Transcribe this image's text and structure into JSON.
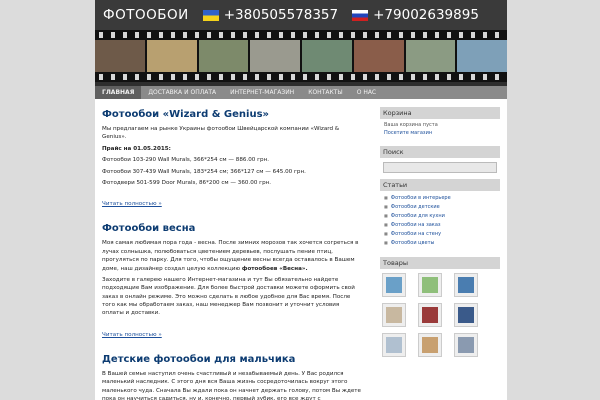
{
  "header": {
    "site_title": "ФОТООБОИ",
    "phone_ua": "+380505578357",
    "phone_ru": "+79002639895",
    "frame_colors": [
      "#6e5a49",
      "#b8a070",
      "#7d8a6a",
      "#9a9a8f",
      "#6f8a73",
      "#8a5d4a",
      "#8b9b83",
      "#7ea0b8"
    ]
  },
  "nav": {
    "items": [
      "Главная",
      "ДОСТАВКА И ОПЛАТА",
      "ИНТЕРНЕТ-МАГАЗИН",
      "КОНТАКТЫ",
      "О НАС"
    ]
  },
  "posts": [
    {
      "title": "Фотообои «Wizard & Genius»",
      "p1": "Мы предлагаем на рынке Украины фотообои Швейцарской компании «Wizard & Genius».",
      "p2": "Прайс  на 01.05.2015:",
      "p3": "Фотообои 103-290 Wall Murals, 366*254 см — 886.00 грн.",
      "p4": "Фотообои 307-439 Wall Murals, 183*254 см; 366*127 см — 645.00 грн.",
      "p5": "Фотодвери 501-599 Door Murals, 86*200 см — 360.00 грн.",
      "more": "Читать полностью »"
    },
    {
      "title": "Фотообои весна",
      "p1": "Моя самая любимая пора года - весна. После зимних морозов так хочется согреться в лучах солнышка, полюбоваться цветением деревьев, послушать пение птиц, прогуляться по парку. Для того, чтобы ощущение весны всегда оставалось в Вашем доме, наш дизайнер создал целую коллекцию",
      "bold": "фотообоев «Весна».",
      "p2": "Заходите в галерею нашего Интернет-магазина и тут Вы обязательно найдете подходящие Вам изображение. Для более быстрой доставки можете оформить свой заказ в онлайн режиме. Это можно сделать в любое удобное для Вас время. После того как мы обработаем заказ, наш менеджер Вам позвонит и уточнит условия оплаты и доставки.",
      "more": "Читать полностью »"
    },
    {
      "title": "Детские фотообои для мальчика",
      "p1": "В Вашей семье наступил очень счастливый и незабываемый день. У Вас родился маленький наследник. С этого дня вся Ваша жизнь сосредоточилась вокруг этого маленького чуда. Сначала Вы ждали пока он начнет держать голову, потом Вы ждете пока он научиться садиться, ну и, конечно, первый зубик, его все ждут с нетерпением. А как же незабываемы первые"
    }
  ],
  "sidebar": {
    "cart_title": "Корзина",
    "cart_empty": "Ваша корзина пуста",
    "cart_link": "Посетите магазин",
    "search_title": "Поиск",
    "articles_title": "Статьи",
    "articles": [
      "Фотообои в интерьере",
      "Фотообои детские",
      "Фотообои для кухни",
      "Фотообои на заказ",
      "Фотообои на стену",
      "Фотообои цветы"
    ],
    "products_title": "Товары",
    "product_colors": [
      "#6aa0c8",
      "#8fbf7a",
      "#4a7db0",
      "#c8b8a0",
      "#9a3a3a",
      "#3a5a8a",
      "#b0c0d0",
      "#c8a070",
      "#8a9ab0"
    ]
  }
}
